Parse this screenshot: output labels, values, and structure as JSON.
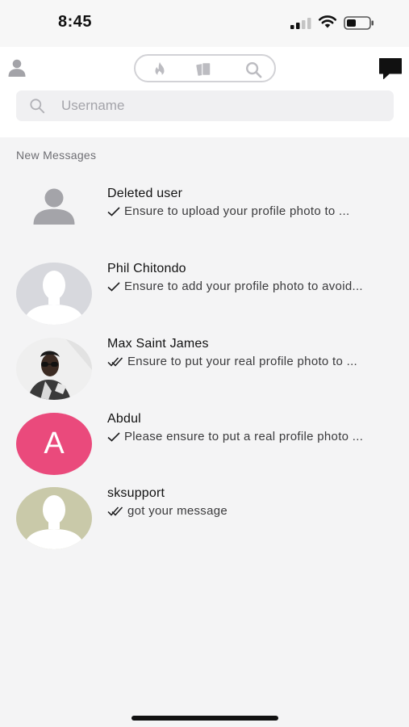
{
  "status_bar": {
    "time": "8:45"
  },
  "nav": {
    "left_icon": "person-icon",
    "tabs": [
      {
        "id": "discover",
        "icon": "flame-icon"
      },
      {
        "id": "cards",
        "icon": "cards-icon"
      },
      {
        "id": "search",
        "icon": "search-icon"
      }
    ],
    "right_icon": "chat-bubble-icon"
  },
  "search": {
    "placeholder": "Username",
    "value": ""
  },
  "section_title": "New Messages",
  "conversations": [
    {
      "name": "Deleted user",
      "preview": "Ensure to upload your profile photo to ...",
      "receipt": "single-check-icon",
      "avatar": "default-person-icon"
    },
    {
      "name": "Phil Chitondo",
      "preview": "Ensure to add your profile photo to avoid...",
      "receipt": "single-check-icon",
      "avatar": "silhouette-photo"
    },
    {
      "name": "Max Saint James",
      "preview": "Ensure to put your real profile photo to ...",
      "receipt": "double-check-icon",
      "avatar": "user-photo"
    },
    {
      "name": "Abdul",
      "preview": "Please ensure to put a real profile photo ...",
      "receipt": "single-check-icon",
      "avatar": "letter-avatar",
      "initial": "A",
      "avatar_color": "#ea4a7c"
    },
    {
      "name": "sksupport",
      "preview": "got your message",
      "receipt": "double-check-icon",
      "avatar": "silhouette-photo"
    }
  ],
  "colors": {
    "accent": "#ea4a7c",
    "background": "#f4f4f5",
    "header": "#ffffff"
  }
}
